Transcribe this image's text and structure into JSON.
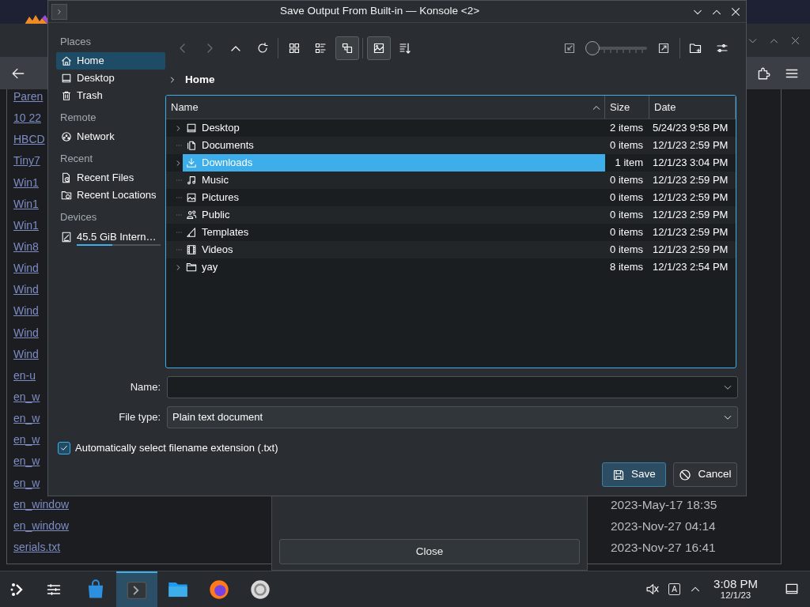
{
  "background_window": {
    "links": [
      "Paren",
      "10 22",
      "HBCD",
      "Tiny7",
      "Win1",
      "Win1",
      "Win1",
      "Win8",
      "Wind",
      "Wind",
      "Wind",
      "Wind",
      "Wind",
      "en-u",
      "en_w",
      "en_w",
      "en_w",
      "en_w",
      "en_w",
      "en_window",
      "en_window",
      "serials.txt"
    ],
    "dates": [
      "2023-May-17 18:35",
      "2023-Nov-27 04:14",
      "2023-Nov-27 16:41"
    ],
    "close_button": "Close"
  },
  "dialog": {
    "title": "Save Output From Built-in — Konsole <2>",
    "places": [
      {
        "heading": "Places",
        "items": [
          {
            "label": "Home",
            "kind": "home",
            "selected": true
          },
          {
            "label": "Desktop",
            "kind": "desktop",
            "selected": false
          },
          {
            "label": "Trash",
            "kind": "trash",
            "selected": false
          }
        ]
      },
      {
        "heading": "Remote",
        "items": [
          {
            "label": "Network",
            "kind": "network",
            "selected": false
          }
        ]
      },
      {
        "heading": "Recent",
        "items": [
          {
            "label": "Recent Files",
            "kind": "recent_file",
            "selected": false
          },
          {
            "label": "Recent Locations",
            "kind": "recent_folder",
            "selected": false
          }
        ]
      },
      {
        "heading": "Devices",
        "items": [
          {
            "label": "45.5 GiB Intern…",
            "kind": "drive",
            "selected": false,
            "level": 0.42
          }
        ]
      }
    ],
    "toolbar": {
      "navigation": [
        {
          "kind": "back",
          "disabled": true
        },
        {
          "kind": "forward",
          "disabled": true
        },
        {
          "kind": "up",
          "disabled": false
        },
        {
          "kind": "reload",
          "disabled": false
        }
      ],
      "view_modes": [
        {
          "kind": "grid",
          "selected": false
        },
        {
          "kind": "list",
          "selected": false
        },
        {
          "kind": "tree",
          "selected": true
        }
      ],
      "preview": {
        "selected": true
      },
      "zoom": {
        "level": 0
      }
    },
    "breadcrumb": [
      "Home"
    ],
    "columns": [
      {
        "label": "Name",
        "sorted": true
      },
      {
        "label": "Size",
        "sorted": false
      },
      {
        "label": "Date",
        "sorted": false
      }
    ],
    "rows": [
      {
        "name": "Desktop",
        "kind": "desktop",
        "size": "2 items",
        "date": "5/24/23 9:58 PM",
        "expandable": true,
        "selected": false
      },
      {
        "name": "Documents",
        "kind": "document",
        "size": "0 items",
        "date": "12/1/23 2:59 PM",
        "expandable": false,
        "selected": false
      },
      {
        "name": "Downloads",
        "kind": "download",
        "size": "1 item",
        "date": "12/1/23 3:04 PM",
        "expandable": true,
        "selected": true
      },
      {
        "name": "Music",
        "kind": "music",
        "size": "0 items",
        "date": "12/1/23 2:59 PM",
        "expandable": false,
        "selected": false
      },
      {
        "name": "Pictures",
        "kind": "picture",
        "size": "0 items",
        "date": "12/1/23 2:59 PM",
        "expandable": false,
        "selected": false
      },
      {
        "name": "Public",
        "kind": "public",
        "size": "0 items",
        "date": "12/1/23 2:59 PM",
        "expandable": false,
        "selected": false
      },
      {
        "name": "Templates",
        "kind": "template",
        "size": "0 items",
        "date": "12/1/23 2:59 PM",
        "expandable": false,
        "selected": false
      },
      {
        "name": "Videos",
        "kind": "video",
        "size": "0 items",
        "date": "12/1/23 2:59 PM",
        "expandable": false,
        "selected": false
      },
      {
        "name": "yay",
        "kind": "folder",
        "size": "8 items",
        "date": "12/1/23 2:54 PM",
        "expandable": true,
        "selected": false
      }
    ],
    "name_field": {
      "label": "Name:"
    },
    "file_type": {
      "label": "File type:",
      "value": "Plain text document"
    },
    "auto_extension": {
      "label": "Automatically select filename extension (.txt)",
      "checked": true
    },
    "buttons": [
      {
        "label": "Save",
        "kind": "save",
        "default": true
      },
      {
        "label": "Cancel",
        "kind": "cancel",
        "default": false
      }
    ]
  },
  "taskbar": {
    "apps": [
      {
        "kind": "bag",
        "selected": false
      },
      {
        "kind": "terminal",
        "selected": true
      },
      {
        "kind": "folder",
        "selected": false
      },
      {
        "kind": "browser",
        "selected": false
      },
      {
        "kind": "vm",
        "selected": false
      }
    ],
    "volume_muted": true,
    "keyboard_indicator": "A",
    "time": "3:08 PM",
    "date": "12/1/23"
  }
}
